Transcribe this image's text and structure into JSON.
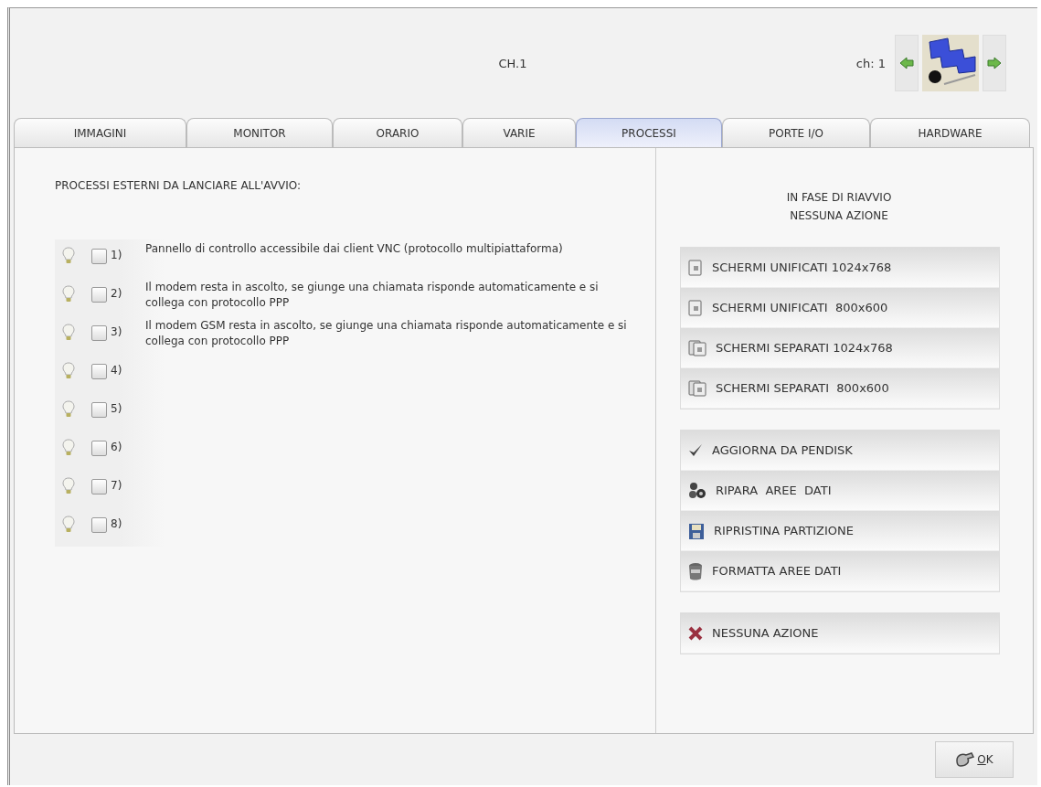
{
  "header": {
    "title": "CH.1",
    "channel": "ch: 1"
  },
  "tabs": [
    {
      "label": "IMMAGINI",
      "selected": false
    },
    {
      "label": "MONITOR",
      "selected": false
    },
    {
      "label": "ORARIO",
      "selected": false
    },
    {
      "label": "VARIE",
      "selected": false
    },
    {
      "label": "PROCESSI",
      "selected": true
    },
    {
      "label": "PORTE I/O",
      "selected": false
    },
    {
      "label": "HARDWARE",
      "selected": false
    }
  ],
  "processes": {
    "heading": "PROCESSI ESTERNI DA LANCIARE ALL'AVVIO:",
    "items": [
      {
        "number": "1)",
        "checked": false,
        "description": "Pannello di controllo accessibile dai client VNC (protocollo multipiattaforma)"
      },
      {
        "number": "2)",
        "checked": false,
        "description": "Il modem resta in ascolto, se giunge una chiamata risponde automaticamente e si collega con protocollo PPP"
      },
      {
        "number": "3)",
        "checked": false,
        "description": "Il modem GSM resta in ascolto, se giunge una chiamata risponde automaticamente e si collega con protocollo PPP"
      },
      {
        "number": "4)",
        "checked": false
      },
      {
        "number": "5)",
        "checked": false
      },
      {
        "number": "6)",
        "checked": false
      },
      {
        "number": "7)",
        "checked": false
      },
      {
        "number": "8)",
        "checked": false
      }
    ]
  },
  "restart": {
    "status": [
      "IN FASE DI RIAVVIO",
      "NESSUNA AZIONE"
    ],
    "groups": [
      [
        {
          "kind": "single",
          "label": "SCHERMI UNIFICATI 1024x768"
        },
        {
          "kind": "single",
          "label": "SCHERMI UNIFICATI  800x600"
        },
        {
          "kind": "double",
          "label": "SCHERMI SEPARATI 1024x768"
        },
        {
          "kind": "double",
          "label": "SCHERMI SEPARATI  800x600"
        }
      ],
      [
        {
          "kind": "check",
          "label": "AGGIORNA DA PENDISK"
        },
        {
          "kind": "repair",
          "label": "RIPARA  AREE  DATI"
        },
        {
          "kind": "restore",
          "label": "RIPRISTINA PARTIZIONE"
        },
        {
          "kind": "format",
          "label": "FORMATTA AREE DATI"
        }
      ],
      [
        {
          "kind": "none",
          "label": "NESSUNA AZIONE"
        }
      ]
    ]
  },
  "footer": {
    "ok": "OK"
  }
}
